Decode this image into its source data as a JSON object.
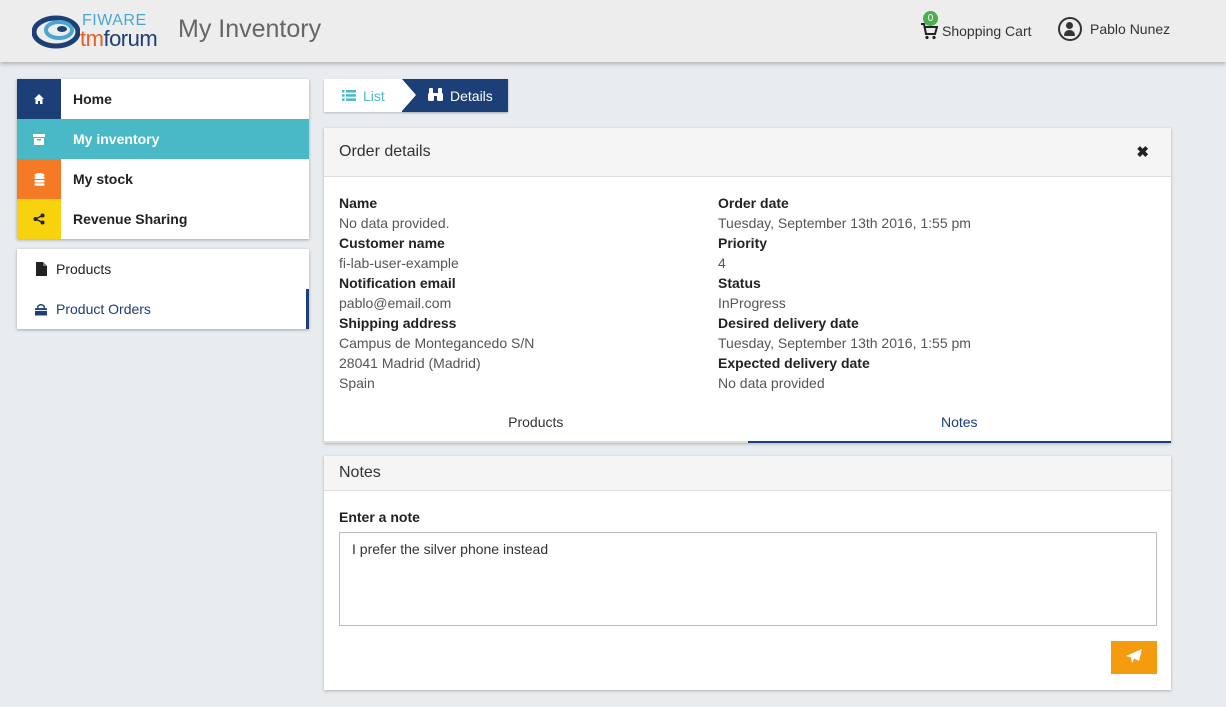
{
  "header": {
    "logo_top": "FIWARE",
    "logo_tm": "tm",
    "logo_forum": "forum",
    "app_title": "My Inventory",
    "cart_label": "Shopping Cart",
    "cart_count": "0",
    "user_name": "Pablo Nunez"
  },
  "menu": {
    "items": [
      {
        "label": "Home",
        "icon": "home-icon",
        "color": "#1b3f76"
      },
      {
        "label": "My inventory",
        "icon": "archive-icon",
        "color": "#4ab9c7"
      },
      {
        "label": "My stock",
        "icon": "database-icon",
        "color": "#f47a25"
      },
      {
        "label": "Revenue Sharing",
        "icon": "share-icon",
        "color": "#f6d30c"
      }
    ]
  },
  "submenu": {
    "items": [
      {
        "label": "Products",
        "icon": "file-icon"
      },
      {
        "label": "Product Orders",
        "icon": "shopping-bag-icon"
      }
    ]
  },
  "breadcrumb": {
    "list": "List",
    "details": "Details"
  },
  "order": {
    "title": "Order details",
    "left": [
      {
        "label": "Name",
        "value": "No data provided."
      },
      {
        "label": "Customer name",
        "value": "fi-lab-user-example"
      },
      {
        "label": "Notification email",
        "value": "pablo@email.com"
      },
      {
        "label": "Shipping address",
        "lines": [
          "Campus de Montegancedo S/N",
          "28041 Madrid (Madrid)",
          "Spain"
        ]
      }
    ],
    "right": [
      {
        "label": "Order date",
        "value": "Tuesday, September 13th 2016, 1:55 pm"
      },
      {
        "label": "Priority",
        "value": "4"
      },
      {
        "label": "Status",
        "value": "InProgress"
      },
      {
        "label": "Desired delivery date",
        "value": "Tuesday, September 13th 2016, 1:55 pm"
      },
      {
        "label": "Expected delivery date",
        "value": "No data provided"
      }
    ],
    "tabs": [
      "Products",
      "Notes"
    ],
    "active_tab": "Notes"
  },
  "notes": {
    "title": "Notes",
    "input_label": "Enter a note",
    "input_value": "I prefer the silver phone instead"
  },
  "colors": {
    "primary": "#1b3f76",
    "accent": "#4ab9c7",
    "send_button": "#f59b0e"
  }
}
